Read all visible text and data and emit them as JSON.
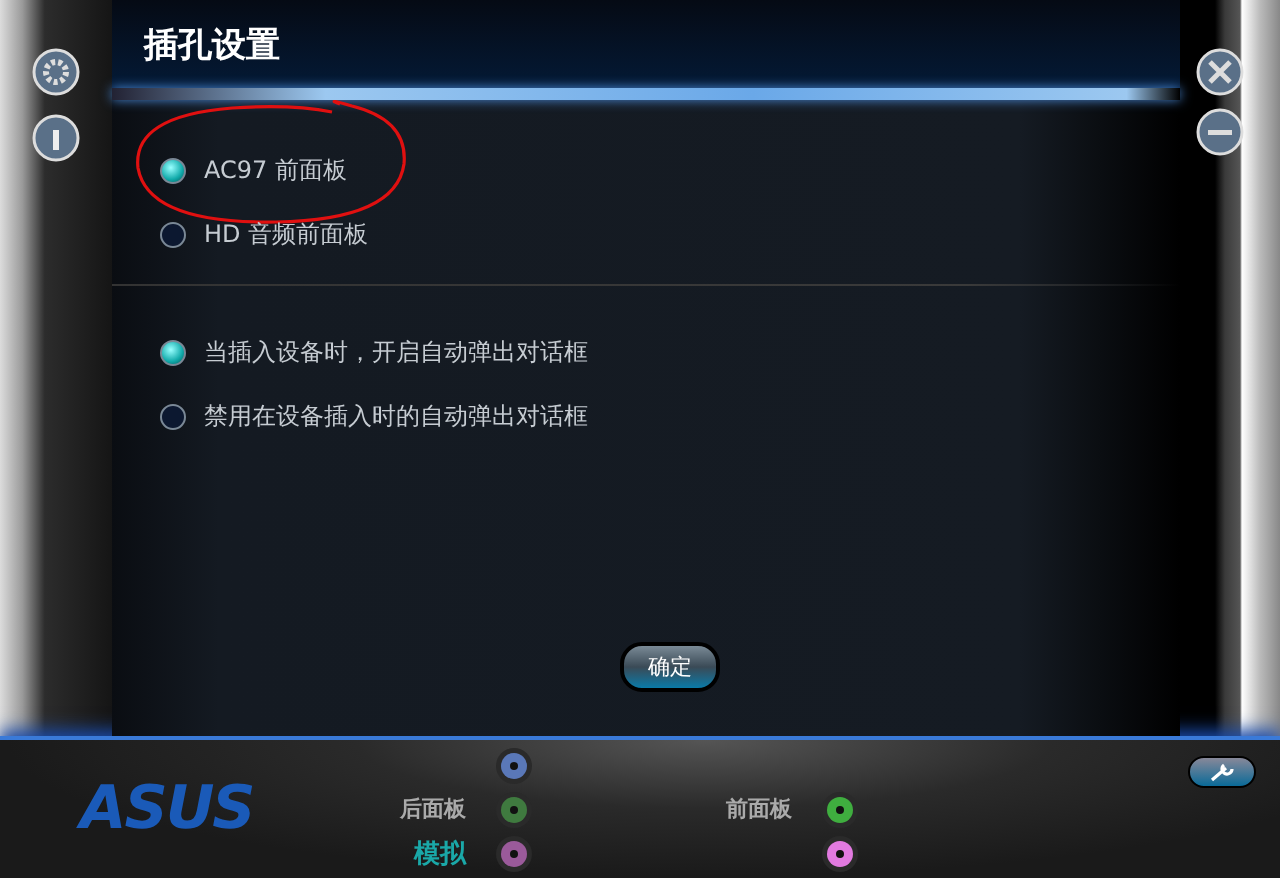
{
  "title": "插孔设置",
  "groups": [
    [
      {
        "label": "AC97 前面板",
        "selected": true
      },
      {
        "label": "HD 音频前面板",
        "selected": false
      }
    ],
    [
      {
        "label": "当插入设备时，开启自动弹出对话框",
        "selected": true
      },
      {
        "label": "禁用在设备插入时的自动弹出对话框",
        "selected": false
      }
    ]
  ],
  "ok_button": "确定",
  "footer": {
    "logo": "ASUS",
    "rear": {
      "label": "后面板",
      "mode": "模拟",
      "jacks": [
        {
          "color": "#5a78b8"
        },
        {
          "color": "#3f7a3f"
        },
        {
          "color": "#9a5a9a"
        }
      ]
    },
    "front": {
      "label": "前面板",
      "jacks": [
        {
          "color": "#3fae3f"
        },
        {
          "color": "#e27ae0"
        }
      ]
    }
  }
}
